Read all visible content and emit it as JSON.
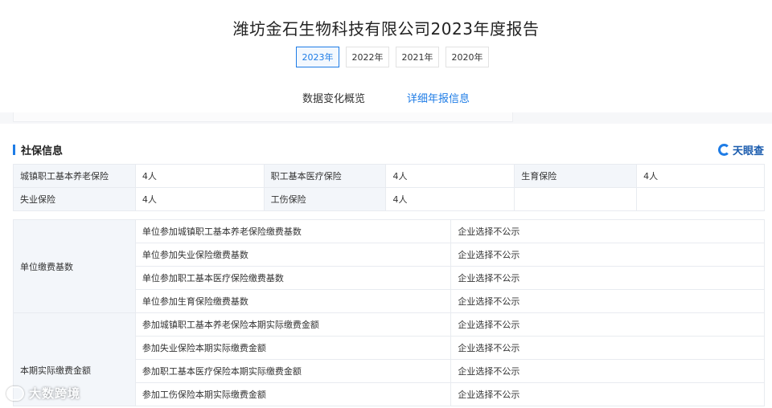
{
  "report": {
    "title": "潍坊金石生物科技有限公司2023年度报告"
  },
  "years": [
    {
      "label": "2023年",
      "active": true
    },
    {
      "label": "2022年",
      "active": false
    },
    {
      "label": "2021年",
      "active": false
    },
    {
      "label": "2020年",
      "active": false
    }
  ],
  "section_tabs": [
    {
      "label": "数据变化概览",
      "active": false
    },
    {
      "label": "详细年报信息",
      "active": true
    }
  ],
  "social_insurance": {
    "title": "社保信息",
    "brand": "天眼查",
    "insured": [
      [
        {
          "label": "城镇职工基本养老保险",
          "value": "4人"
        },
        {
          "label": "职工基本医疗保险",
          "value": "4人"
        },
        {
          "label": "生育保险",
          "value": "4人"
        }
      ],
      [
        {
          "label": "失业保险",
          "value": "4人"
        },
        {
          "label": "工伤保险",
          "value": "4人"
        }
      ]
    ],
    "unit_base": {
      "group_label": "单位缴费基数",
      "rows": [
        {
          "label": "单位参加城镇职工基本养老保险缴费基数",
          "value": "企业选择不公示"
        },
        {
          "label": "单位参加失业保险缴费基数",
          "value": "企业选择不公示"
        },
        {
          "label": "单位参加职工基本医疗保险缴费基数",
          "value": "企业选择不公示"
        },
        {
          "label": "单位参加生育保险缴费基数",
          "value": "企业选择不公示"
        }
      ]
    },
    "actual_paid": {
      "group_label": "本期实际缴费金额",
      "rows": [
        {
          "label": "参加城镇职工基本养老保险本期实际缴费金额",
          "value": "企业选择不公示"
        },
        {
          "label": "参加失业保险本期实际缴费金额",
          "value": "企业选择不公示"
        },
        {
          "label": "参加职工基本医疗保险本期实际缴费金额",
          "value": "企业选择不公示"
        },
        {
          "label": "参加工伤保险本期实际缴费金额",
          "value": "企业选择不公示"
        }
      ]
    }
  },
  "watermark": {
    "text": "大数跨境"
  }
}
